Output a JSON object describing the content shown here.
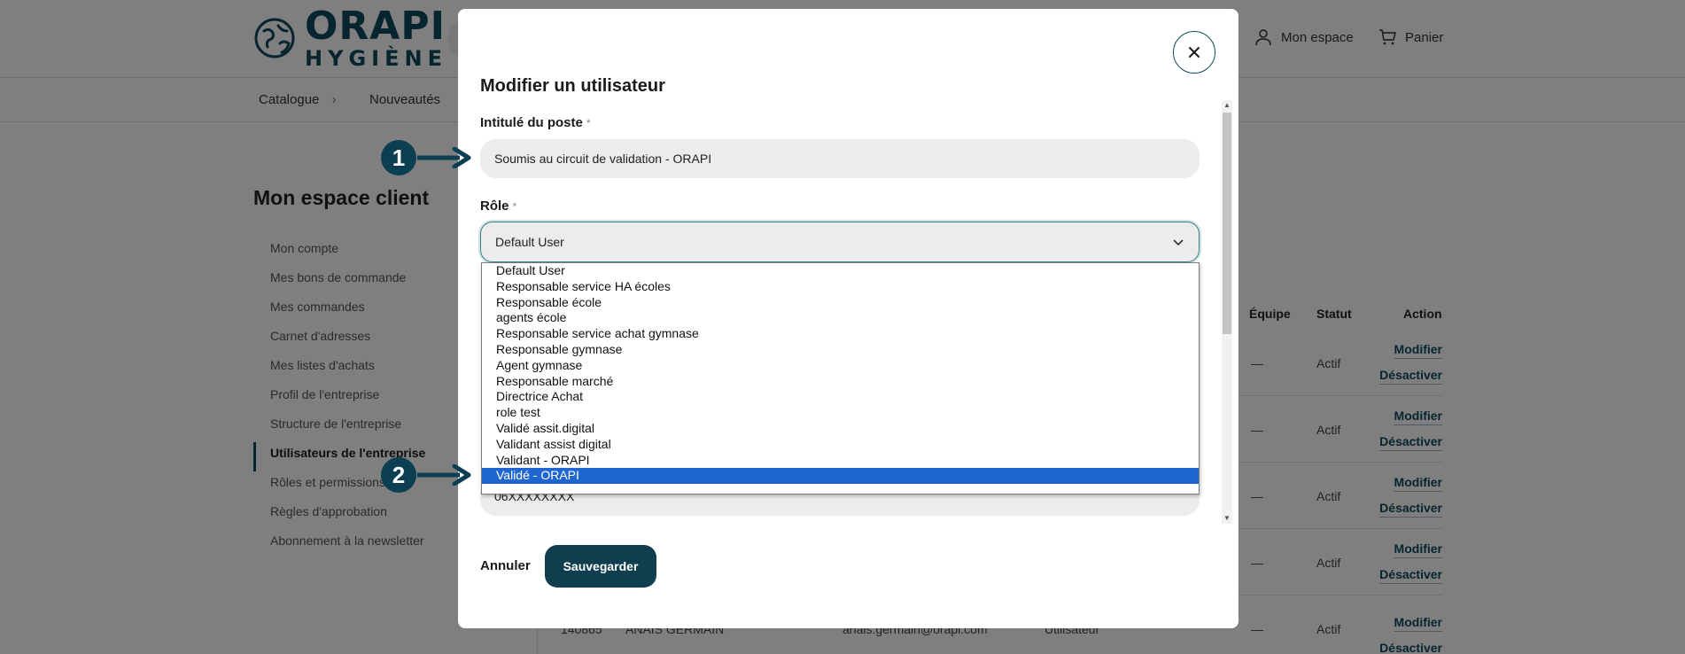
{
  "header": {
    "logo_brand": "ORAPI",
    "logo_sub": "HYGIÈNE",
    "my_space": "Mon espace",
    "cart": "Panier"
  },
  "nav": {
    "catalogue": "Catalogue",
    "chevron": "›",
    "news": "Nouveautés"
  },
  "sidebar": {
    "title": "Mon espace client",
    "items": [
      {
        "label": "Mon compte"
      },
      {
        "label": "Mes bons de commande"
      },
      {
        "label": "Mes commandes"
      },
      {
        "label": "Carnet d'adresses"
      },
      {
        "label": "Mes listes d'achats"
      },
      {
        "label": "Profil de l'entreprise"
      },
      {
        "label": "Structure de l'entreprise"
      },
      {
        "label": "Utilisateurs de l'entreprise"
      },
      {
        "label": "Rôles et permissions"
      },
      {
        "label": "Règles d'approbation"
      },
      {
        "label": "Abonnement à la newsletter"
      }
    ]
  },
  "table": {
    "headers": {
      "team": "Équipe",
      "status": "Statut",
      "action": "Action"
    },
    "rows": [
      {
        "team": "—",
        "status": "Actif",
        "modify": "Modifier",
        "deactivate": "Désactiver"
      },
      {
        "team": "—",
        "status": "Actif",
        "modify": "Modifier",
        "deactivate": "Désactiver"
      },
      {
        "team": "—",
        "status": "Actif",
        "modify": "Modifier",
        "deactivate": "Désactiver"
      },
      {
        "team": "—",
        "status": "Actif",
        "modify": "Modifier",
        "deactivate": "Désactiver"
      },
      {
        "id": "140865",
        "name": "ANAIS GERMAIN",
        "email": "anais.germain@orapi.com",
        "role": "Utilisateur",
        "team": "—",
        "status": "Actif",
        "modify": "Modifier",
        "deactivate": "Désactiver"
      }
    ]
  },
  "modal": {
    "title": "Modifier un utilisateur",
    "job_label": "Intitulé du poste",
    "required_mark": "*",
    "job_value": "Soumis au circuit de validation - ORAPI",
    "role_label": "Rôle",
    "role_value": "Default User",
    "role_options": [
      {
        "label": "Default User",
        "selected": false
      },
      {
        "label": "Responsable service HA écoles",
        "selected": false
      },
      {
        "label": "Responsable école",
        "selected": false
      },
      {
        "label": "agents école",
        "selected": false
      },
      {
        "label": "Responsable service achat gymnase",
        "selected": false
      },
      {
        "label": "Responsable gymnase",
        "selected": false
      },
      {
        "label": "Agent gymnase",
        "selected": false
      },
      {
        "label": "Responsable marché",
        "selected": false
      },
      {
        "label": "Directrice Achat",
        "selected": false
      },
      {
        "label": "role test",
        "selected": false
      },
      {
        "label": "Validé assit.digital",
        "selected": false
      },
      {
        "label": "Validant assist digital",
        "selected": false
      },
      {
        "label": "Validant - ORAPI",
        "selected": false
      },
      {
        "label": "Validé - ORAPI",
        "selected": true
      }
    ],
    "phone_value": "06XXXXXXXX",
    "cancel_label": "Annuler",
    "save_label": "Sauvegarder"
  },
  "callouts": [
    {
      "number": "1"
    },
    {
      "number": "2"
    }
  ],
  "colors": {
    "brand": "#0f4a5c",
    "primary_button": "#0f3e4e",
    "selected_option": "#1f66d0",
    "callout": "#0d3f52",
    "overlay": "rgba(0,0,0,0.5)"
  }
}
